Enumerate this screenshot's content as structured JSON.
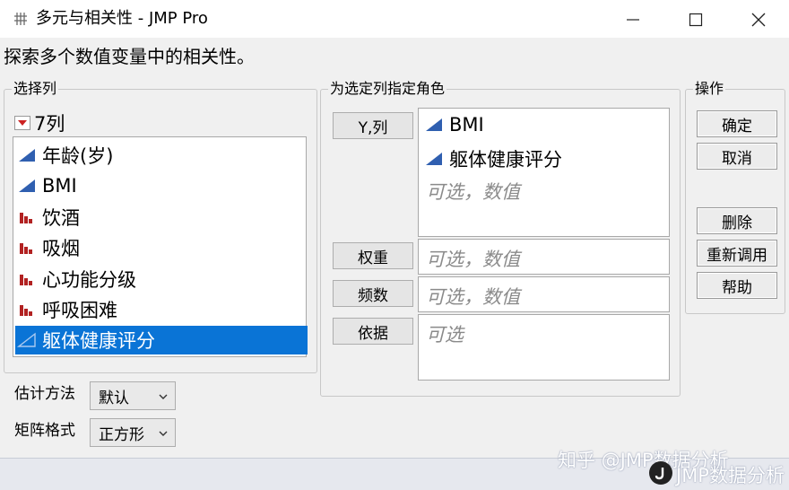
{
  "window": {
    "title": "多元与相关性 - JMP Pro"
  },
  "instruction": "探索多个数值变量中的相关性。",
  "select_columns": {
    "legend": "选择列",
    "count_label": "7列",
    "items": [
      {
        "label": "年龄(岁)",
        "icon": "continuous-icon"
      },
      {
        "label": "BMI",
        "icon": "continuous-icon"
      },
      {
        "label": "饮酒",
        "icon": "ordinal-icon"
      },
      {
        "label": "吸烟",
        "icon": "ordinal-icon"
      },
      {
        "label": "心功能分级",
        "icon": "ordinal-icon"
      },
      {
        "label": "呼吸困难",
        "icon": "ordinal-icon"
      },
      {
        "label": "躯体健康评分",
        "icon": "continuous-icon",
        "selected": true
      }
    ]
  },
  "roles": {
    "legend": "为选定列指定角色",
    "y": {
      "button": "Y,列",
      "items": [
        "BMI",
        "躯体健康评分"
      ],
      "placeholder": "可选，数值"
    },
    "weight": {
      "button": "权重",
      "placeholder": "可选，数值"
    },
    "freq": {
      "button": "频数",
      "placeholder": "可选，数值"
    },
    "by": {
      "button": "依据",
      "placeholder": "可选"
    }
  },
  "actions": {
    "legend": "操作",
    "ok": "确定",
    "cancel": "取消",
    "remove": "删除",
    "recall": "重新调用",
    "help": "帮助"
  },
  "options": {
    "estimation_label": "估计方法",
    "estimation_value": "默认",
    "matrix_label": "矩阵格式",
    "matrix_value": "正方形"
  },
  "watermark": {
    "line1": "知乎 @JMP数据分析",
    "line2": "JMP数据分析"
  },
  "colors": {
    "selection": "#0a74d6",
    "continuous_icon": "#2f5fb0",
    "ordinal_icon": "#b22222",
    "disclosure": "#cc2222"
  }
}
